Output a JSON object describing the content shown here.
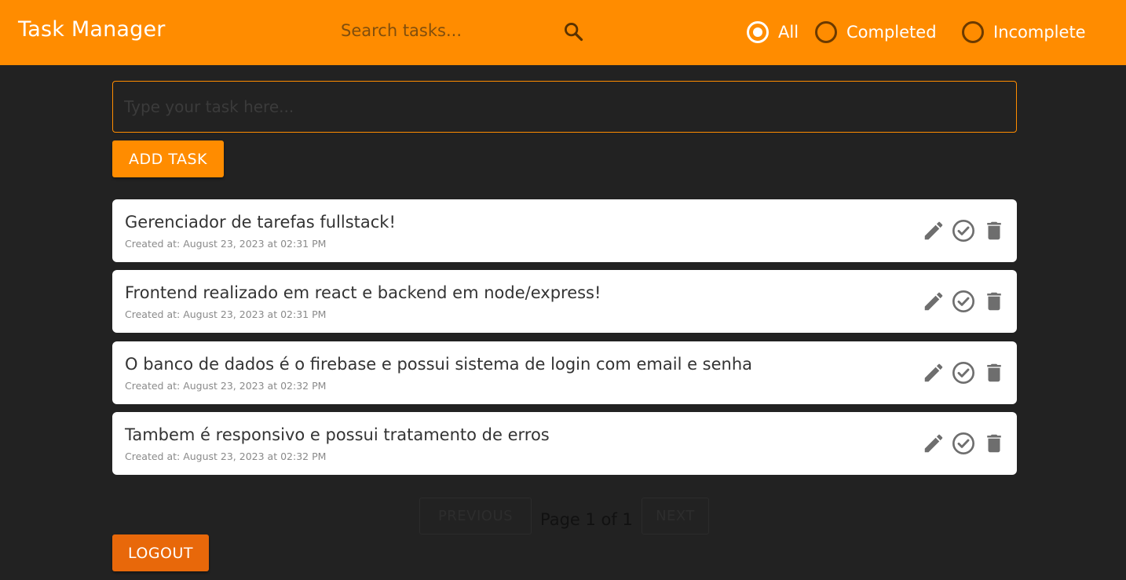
{
  "header": {
    "title": "Task Manager",
    "search_placeholder": "Search tasks...",
    "search_icon": "search-icon",
    "filters": [
      {
        "label": "All",
        "selected": true
      },
      {
        "label": "Completed",
        "selected": false
      },
      {
        "label": "Incomplete",
        "selected": false
      }
    ]
  },
  "composer": {
    "placeholder": "Type your task here...",
    "value": "",
    "add_label": "ADD TASK"
  },
  "tasks": [
    {
      "title": "Gerenciador de tarefas fullstack!",
      "created": "Created at: August 23, 2023 at 02:31 PM"
    },
    {
      "title": "Frontend realizado em react e backend em node/express!",
      "created": "Created at: August 23, 2023 at 02:31 PM"
    },
    {
      "title": "O banco de dados é o firebase e possui sistema de login com email e senha",
      "created": "Created at: August 23, 2023 at 02:32 PM"
    },
    {
      "title": "Tambem é responsivo e possui tratamento de erros",
      "created": "Created at: August 23, 2023 at 02:32 PM"
    }
  ],
  "task_actions": {
    "edit_icon": "pencil-icon",
    "complete_icon": "check-circle-icon",
    "delete_icon": "trash-icon"
  },
  "pagination": {
    "previous_label": "PREVIOUS",
    "next_label": "NEXT",
    "page_text": "Page 1 of 1"
  },
  "logout_label": "LOGOUT",
  "colors": {
    "accent": "#ff8c00",
    "background": "#222222",
    "logout": "#e8680a",
    "card": "#ffffff",
    "icon": "#6e6e6e"
  }
}
